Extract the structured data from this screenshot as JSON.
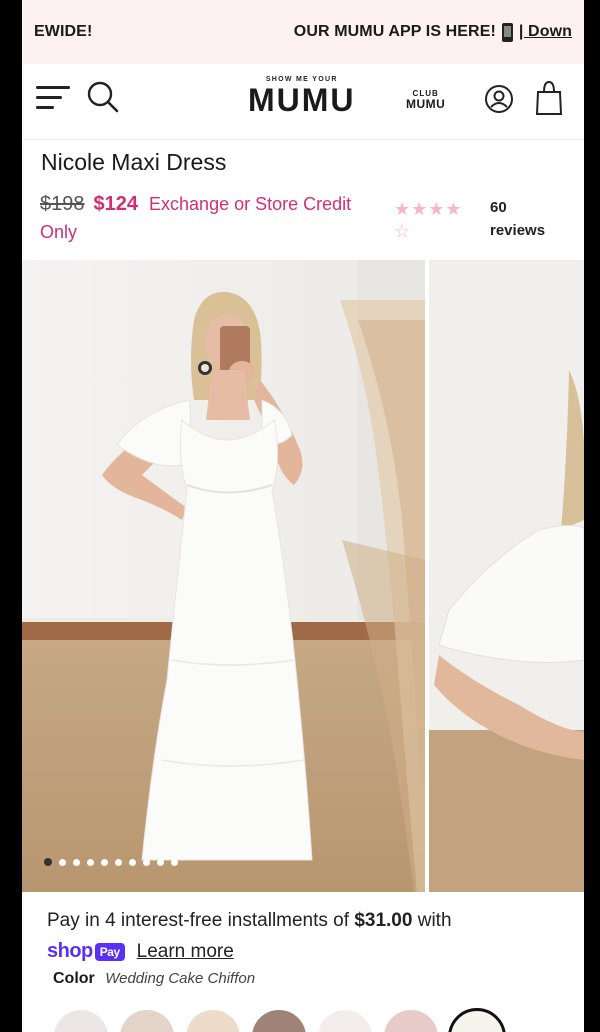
{
  "announcement": {
    "left_text": "EWIDE!",
    "right_text": "OUR MUMU APP IS HERE!",
    "link_text": "| Down"
  },
  "header": {
    "logo_small": "SHOW ME YOUR",
    "logo_big": "MUMU",
    "club_top": "CLUB",
    "club_bottom": "MUMU"
  },
  "product": {
    "title": "Nicole Maxi Dress",
    "old_price": "$198",
    "new_price": "$124",
    "credit_note": "Exchange or Store Credit Only",
    "rating": 4,
    "rating_max": 5,
    "review_count": "60",
    "review_label": "reviews"
  },
  "gallery": {
    "image_count": 10,
    "active_index": 0
  },
  "installments": {
    "text_before": "Pay in 4 interest-free installments of ",
    "amount": "$31.00",
    "text_after": " with",
    "shop_logo": "shop",
    "pay_badge": "Pay",
    "learn_more": "Learn more"
  },
  "color": {
    "label": "Color",
    "value": "Wedding Cake Chiffon",
    "swatches": [
      "#ece6e6",
      "#e5d4c9",
      "#eddcc9",
      "#9e8376",
      "#f3eeeb",
      "#e6cbc8",
      "#f6f4ef"
    ],
    "selected_index": 6
  },
  "colors": {
    "accent": "#d22e73",
    "shop_purple": "#5a31f4",
    "announce_bg": "#fdf1f2"
  }
}
